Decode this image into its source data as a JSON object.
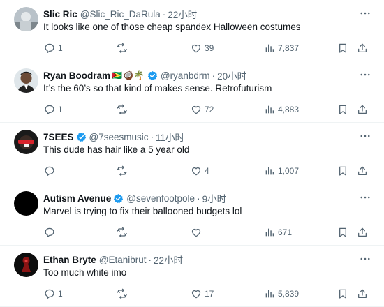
{
  "tweets": [
    {
      "name": "Slic Ric",
      "emoji": "",
      "verified": false,
      "handle": "@Slic_Ric_DaRula",
      "time": "22小时",
      "text": "It looks like one of those cheap spandex Halloween costumes",
      "replies": "1",
      "retweets": "",
      "likes": "39",
      "views": "7,837",
      "avatar_color": "#b9c2c9"
    },
    {
      "name": "Ryan Boodram",
      "emoji": "🇬🇾🥥🌴",
      "verified": true,
      "handle": "@ryanbdrm",
      "time": "20小时",
      "text": "It’s the 60’s so that kind of makes sense. Retrofuturism",
      "replies": "1",
      "retweets": "",
      "likes": "72",
      "views": "4,883",
      "avatar_color": "#6b4a36"
    },
    {
      "name": "7SEES",
      "emoji": "",
      "verified": true,
      "handle": "@7seesmusic",
      "time": "11小时",
      "text": "This dude has hair like a 5 year old",
      "replies": "",
      "retweets": "",
      "likes": "4",
      "views": "1,007",
      "avatar_color": "#1a1a1a"
    },
    {
      "name": "Autism Avenue",
      "emoji": "",
      "verified": true,
      "handle": "@sevenfootpole",
      "time": "9小时",
      "text": "Marvel is trying to fix their ballooned budgets lol",
      "replies": "",
      "retweets": "",
      "likes": "",
      "views": "671",
      "avatar_color": "#000000"
    },
    {
      "name": "Ethan Bryte",
      "emoji": "",
      "verified": false,
      "handle": "@Etanibrut",
      "time": "22小时",
      "text": "Too much white imo",
      "replies": "1",
      "retweets": "",
      "likes": "17",
      "views": "5,839",
      "avatar_color": "#0d0d0d"
    }
  ],
  "colors": {
    "text": "#0f1419",
    "secondary": "#536471",
    "verified": "#1d9bf0",
    "divider": "#eff3f4"
  }
}
